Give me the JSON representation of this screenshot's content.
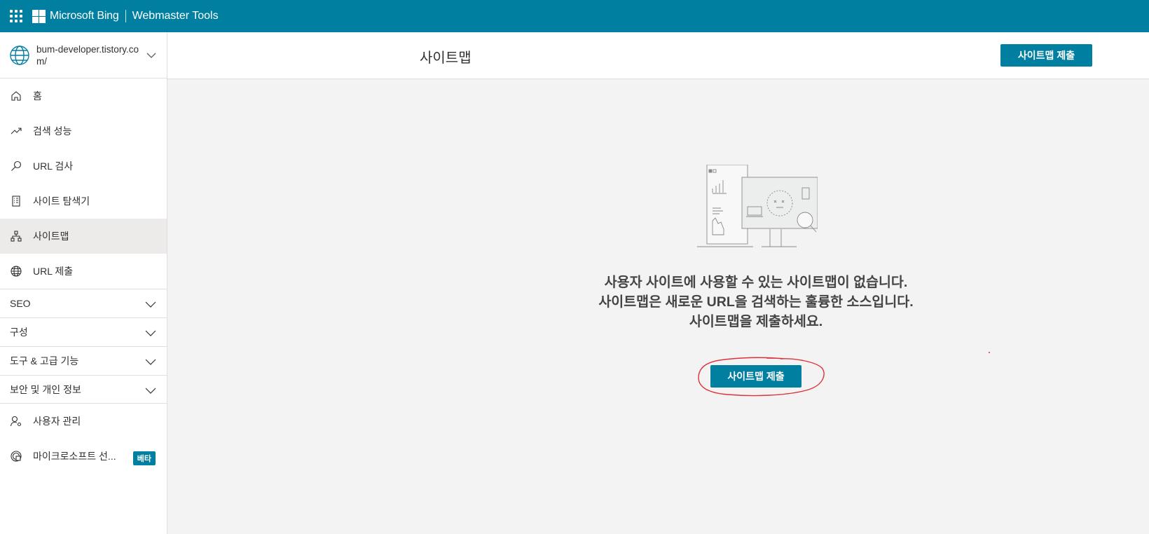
{
  "topbar": {
    "brand": "Microsoft Bing",
    "product": "Webmaster Tools",
    "accent_color": "#007fa1",
    "waffle_icon": "app-launcher-icon"
  },
  "site_selector": {
    "site": "bum-developer.tistory.com/",
    "icon": "globe-icon"
  },
  "sidebar": {
    "items": [
      {
        "label": "홈",
        "icon": "home-icon"
      },
      {
        "label": "검색 성능",
        "icon": "trend-icon"
      },
      {
        "label": "URL 검사",
        "icon": "search-icon"
      },
      {
        "label": "사이트 탐색기",
        "icon": "list-icon"
      },
      {
        "label": "사이트맵",
        "icon": "sitemap-icon",
        "active": true
      },
      {
        "label": "URL 제출",
        "icon": "globe-icon"
      }
    ],
    "groups": [
      {
        "label": "SEO"
      },
      {
        "label": "구성"
      },
      {
        "label": "도구 & 고급 기능"
      },
      {
        "label": "보안 및 개인 정보"
      }
    ],
    "bottom_items": [
      {
        "label": "사용자 관리",
        "icon": "user-settings-icon"
      },
      {
        "label": "마이크로소프트 선...",
        "icon": "clarity-icon",
        "badge": "베타"
      }
    ]
  },
  "header": {
    "title": "사이트맵",
    "submit_button": "사이트맵 제출"
  },
  "empty_state": {
    "line1": "사용자 사이트에 사용할 수 있는 사이트맵이 없습니다.",
    "line2": "사이트맵은 새로운 URL을 검색하는 훌륭한 소스입니다.",
    "line3": "사이트맵을 제출하세요.",
    "button": "사이트맵 제출",
    "annotation_color": "#e0303a"
  }
}
